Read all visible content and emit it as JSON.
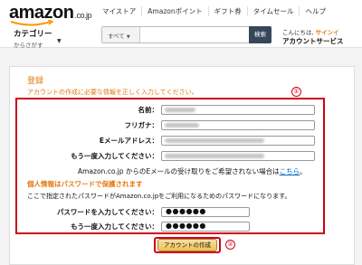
{
  "header": {
    "logo": "amazon",
    "logo_tld": ".co.jp",
    "nav": [
      "マイストア",
      "Amazonポイント",
      "ギフト券",
      "タイムセール",
      "ヘルプ"
    ],
    "category": {
      "title": "カテゴリー",
      "subtitle": "からさがす"
    },
    "search": {
      "dropdown": "すべて",
      "button": "検索",
      "value": ""
    },
    "greeting": "こんにちは,",
    "signin": "サインイ",
    "account": "アカウントサービス"
  },
  "form": {
    "title": "登録",
    "intro": "アカウントの作成に必要な情報を正しく入力してください。",
    "badge_1": "①",
    "badge_2": "②",
    "name_label": "名前：",
    "furigana_label": "フリガナ：",
    "email_label": "Eメールアドレス：",
    "email_confirm_label": "もう一度入力してください：",
    "email_note": "Amazon.co.jp からのEメールの受け取りをご希望されない場合は",
    "email_note_link": "こちら",
    "email_note_end": "。",
    "privacy_heading": "個人情報はパスワードで保護されます",
    "password_note": "ここで指定されたパスワードがAmazon.co.jpをご利用になるためのパスワードになります。",
    "password_label": "パスワードを入力してください：",
    "password_confirm_label": "もう一度入力してください：",
    "password_value": "●●●●●●",
    "password_confirm_value": "●●●●●●",
    "submit": "アカウントの作成"
  },
  "colors": {
    "accent": "#e47911",
    "highlight": "#d0021b",
    "link": "#0066c0",
    "search_button": "#37475a"
  }
}
